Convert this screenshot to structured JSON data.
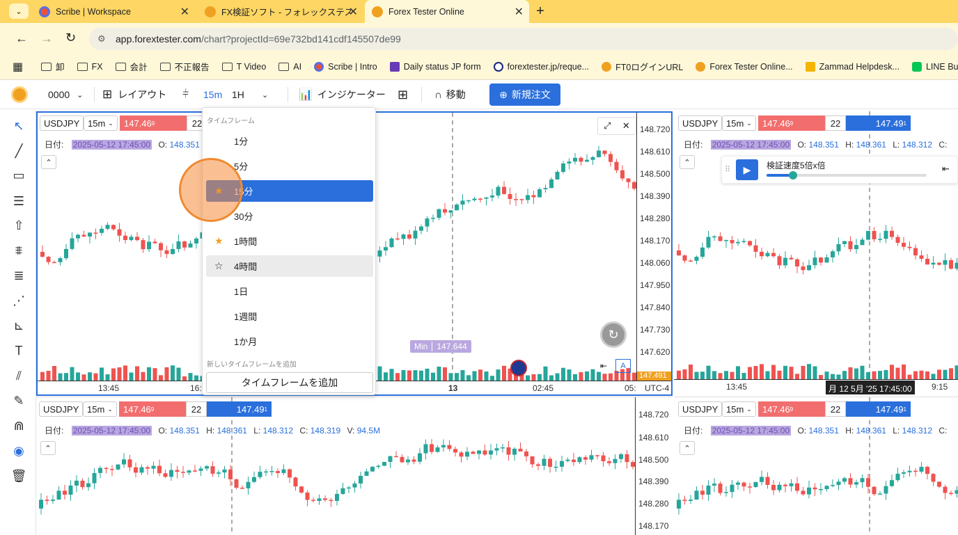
{
  "tabs": [
    {
      "title": "Scribe | Workspace",
      "active": false
    },
    {
      "title": "FX検証ソフト - フォレックステスター",
      "active": false
    },
    {
      "title": "Forex Tester Online",
      "active": true
    }
  ],
  "address": {
    "host": "app.forextester.com",
    "path": "/chart?projectId=69e732bd141cdf145507de99"
  },
  "bookmarks": [
    "卸",
    "FX",
    "会計",
    "不正報告",
    "T Video",
    "AI",
    "Scribe | Intro",
    "Daily status JP form",
    "forextester.jp/reque...",
    "FT0ログインURL",
    "Forex Tester Online...",
    "Zammad Helpdesk...",
    "LINE Busin"
  ],
  "toolbar": {
    "account": "0000",
    "layout": "レイアウト",
    "tf_active": "15m",
    "tf_alt": "1H",
    "indicator": "インジケーター",
    "move": "移動",
    "new_order": "新規注文"
  },
  "pane": {
    "symbol": "USDJPY",
    "tf": "15m",
    "sell": "147.46",
    "sell_sup": "9",
    "qty": "22",
    "buy": "147.49",
    "buy_sup": "1",
    "date_label": "日付:",
    "date": "2025-05-12 17:45:00",
    "o_label": "O:",
    "o": "148.351",
    "h_label": "H:",
    "h": "148.361",
    "l_label": "L:",
    "l": "148.312",
    "c_label": "C:",
    "c": "148.319",
    "v_label": "V:",
    "v": "94.5M",
    "price_axis": [
      "148.720",
      "148.610",
      "148.500",
      "148.390",
      "148.280",
      "148.170",
      "148.060",
      "147.950",
      "147.840",
      "147.730",
      "147.620"
    ],
    "time_axis_main": [
      "13:45",
      "16:",
      "13",
      "02:45",
      "05:"
    ],
    "time_axis_right": [
      "13:45",
      "9:15"
    ],
    "tz": "UTC-4",
    "min_label": "Min",
    "min_value": "147.644",
    "crosshair_time": "月 12 5月 '25 17:45:00",
    "last_price": "147.491"
  },
  "player": {
    "label": "検証速度5倍x倍"
  },
  "dropdown": {
    "header": "タイムフレーム",
    "items": [
      {
        "label": "1分",
        "star": "",
        "state": ""
      },
      {
        "label": "5分",
        "star": "",
        "state": ""
      },
      {
        "label": "15分",
        "star": "★",
        "state": "hl"
      },
      {
        "label": "30分",
        "star": "",
        "state": ""
      },
      {
        "label": "1時間",
        "star": "★",
        "state": ""
      },
      {
        "label": "4時間",
        "star": "☆",
        "state": "hv"
      },
      {
        "label": "1日",
        "star": "",
        "state": ""
      },
      {
        "label": "1週間",
        "star": "",
        "state": ""
      },
      {
        "label": "1か月",
        "star": "",
        "state": ""
      }
    ],
    "footer_label": "新しいタイムフレームを追加",
    "add_button": "タイムフレームを追加"
  },
  "colors": {
    "up": "#26a69a",
    "down": "#ef5350",
    "accent": "#2a6fdc",
    "tabbar": "#fdd663"
  }
}
